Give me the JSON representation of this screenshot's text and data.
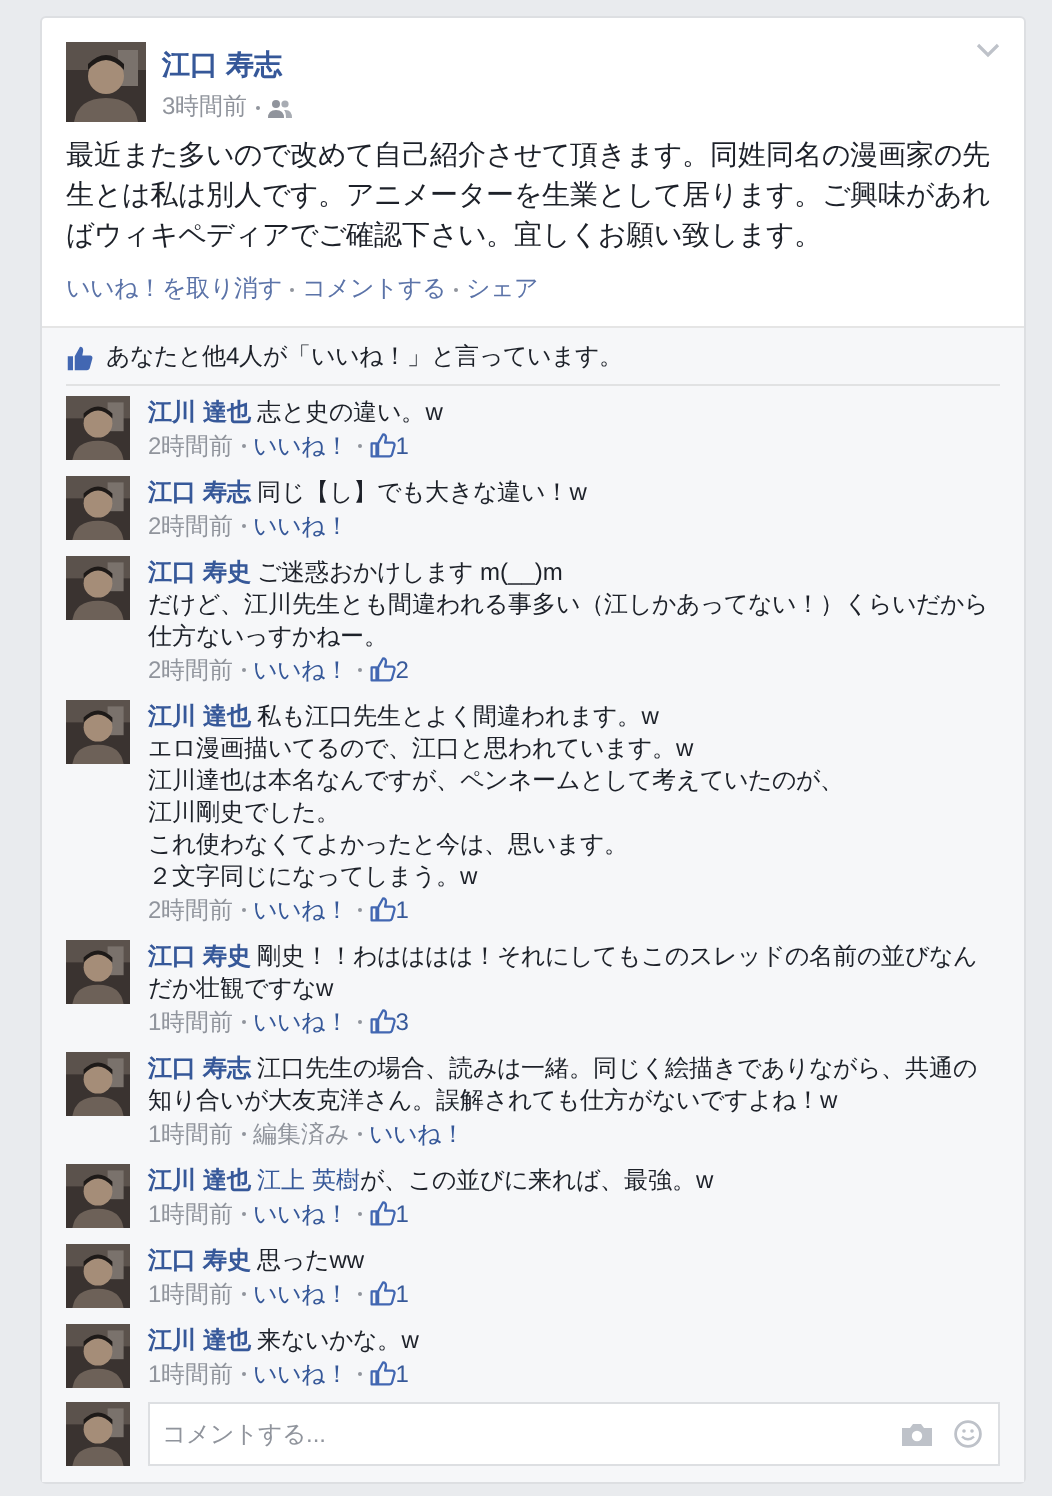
{
  "post": {
    "author": "江口 寿志",
    "time": "3時間前",
    "text": "最近また多いので改めて自己紹介させて頂きます。同姓同名の漫画家の先生とは私は別人です。アニメーターを生業として居ります。ご興味があればウィキペディアでご確認下さい。宜しくお願い致します。",
    "actions": [
      "いいね！を取り消す",
      "コメントする",
      "シェア"
    ]
  },
  "likes_summary": "あなたと他4人が「いいね！」と言っています。",
  "comments": [
    {
      "author": "江川 達也",
      "text": "志と史の違い。w",
      "time": "2時間前",
      "like": "いいね！",
      "likes": "1"
    },
    {
      "author": "江口 寿志",
      "text": "同じ【し】でも大きな違い！w",
      "time": "2時間前",
      "like": "いいね！"
    },
    {
      "author": "江口 寿史",
      "text": "ご迷惑おかけします m(__)m",
      "more_lines": [
        "だけど、江川先生とも間違われる事多い（江しかあってない！）くらいだから仕方ないっすかねー。"
      ],
      "time": "2時間前",
      "like": "いいね！",
      "likes": "2"
    },
    {
      "author": "江川 達也",
      "text": "私も江口先生とよく間違われます。w",
      "more_lines": [
        "エロ漫画描いてるので、江口と思われています。w",
        "江川達也は本名なんですが、ペンネームとして考えていたのが、",
        "江川剛史でした。",
        "これ使わなくてよかったと今は、思います。",
        "２文字同じになってしまう。w"
      ],
      "time": "2時間前",
      "like": "いいね！",
      "likes": "1"
    },
    {
      "author": "江口 寿史",
      "text": "剛史！！わはははは！それにしてもこのスレッドの名前の並びなんだか壮観ですなw",
      "time": "1時間前",
      "like": "いいね！",
      "likes": "3"
    },
    {
      "author": "江口 寿志",
      "text": "江口先生の場合、読みは一緒。同じく絵描きでありながら、共通の知り合いが大友克洋さん。誤解されても仕方がないですよね！w",
      "time": "1時間前",
      "edited": "編集済み",
      "like": "いいね！"
    },
    {
      "author": "江川 達也",
      "mention": "江上 英樹",
      "text": "が、この並びに来れば、最強。w",
      "time": "1時間前",
      "like": "いいね！",
      "likes": "1"
    },
    {
      "author": "江口 寿史",
      "text": "思ったww",
      "time": "1時間前",
      "like": "いいね！",
      "likes": "1"
    },
    {
      "author": "江川 達也",
      "text": "来ないかな。w",
      "time": "1時間前",
      "like": "いいね！",
      "likes": "1"
    }
  ],
  "comment_box": {
    "placeholder": "コメントする..."
  }
}
